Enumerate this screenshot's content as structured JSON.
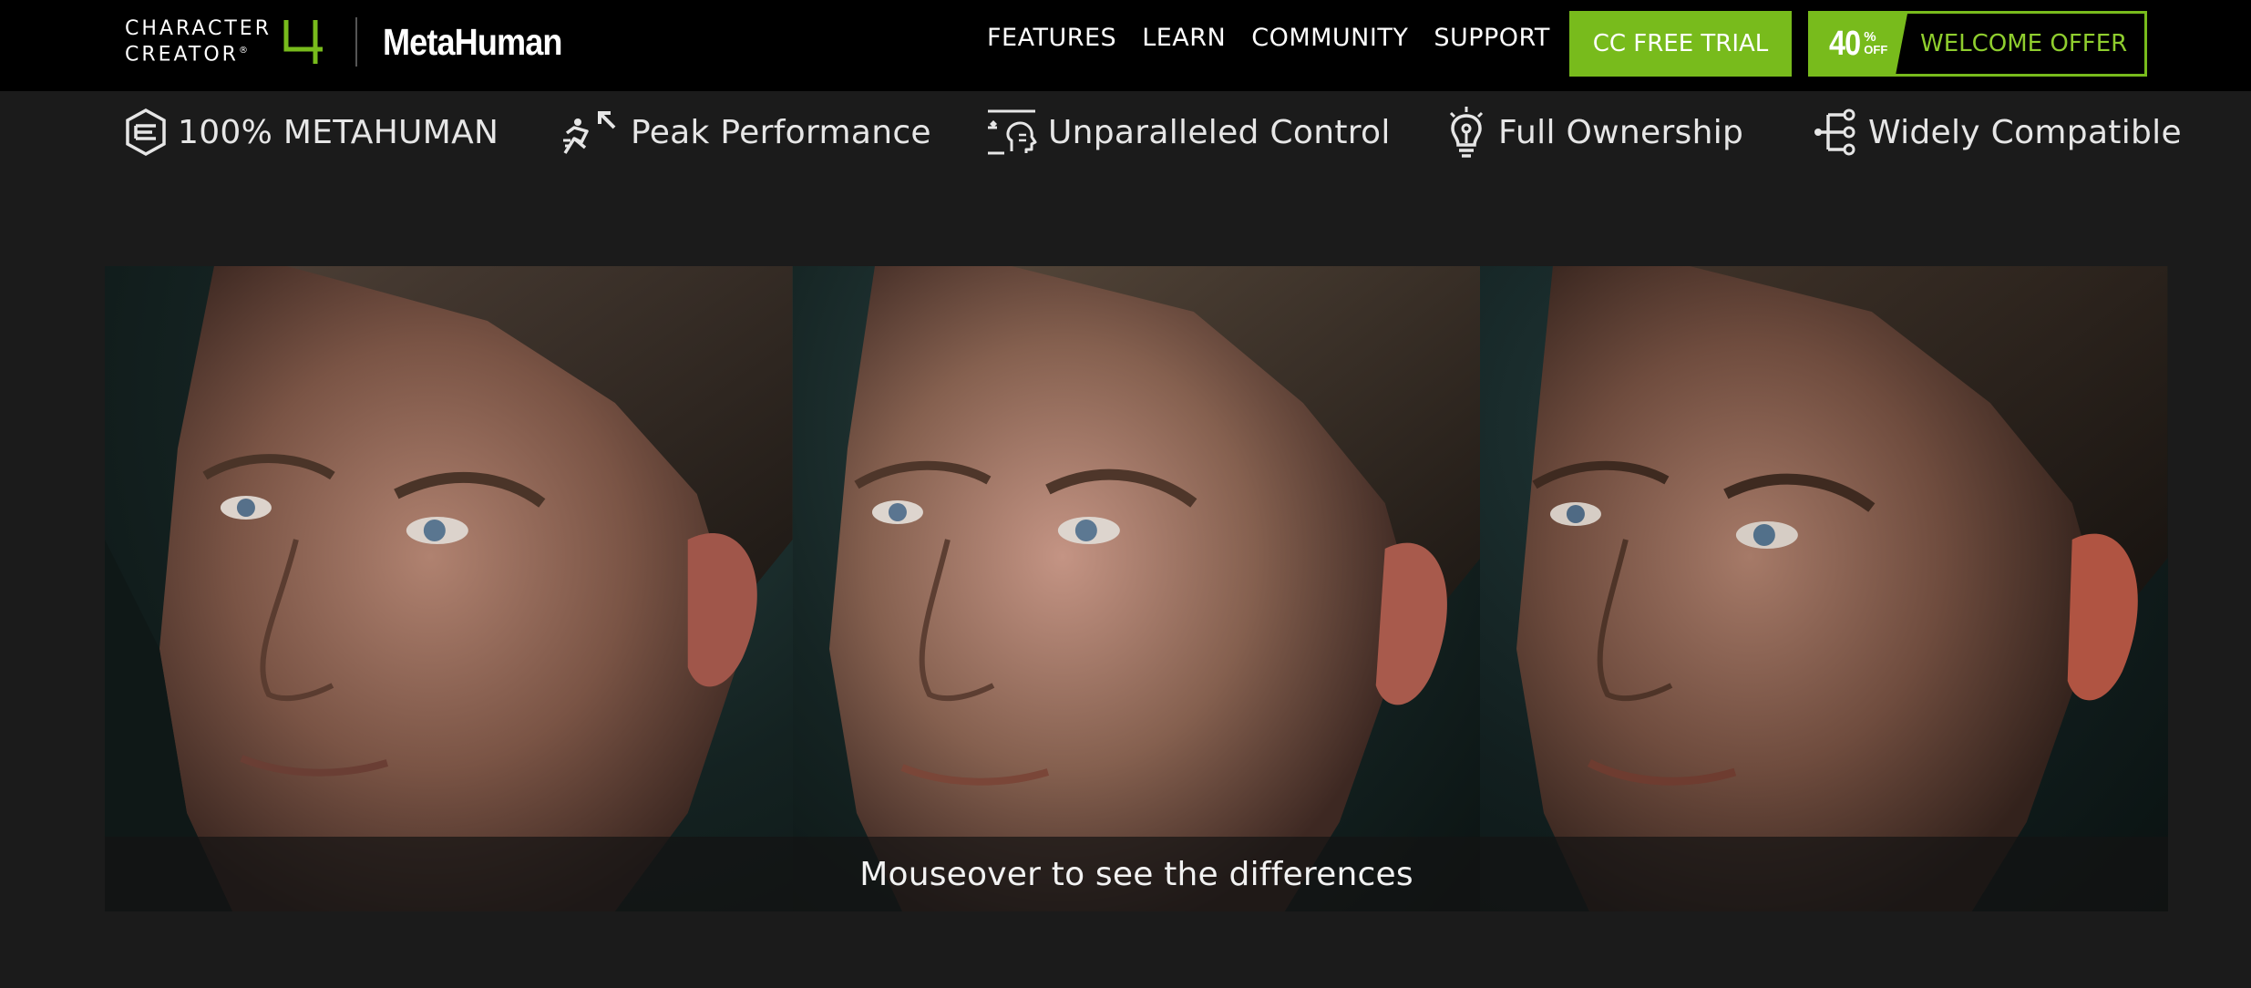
{
  "logo": {
    "line1": "CHARACTER",
    "line2": "CREATOR",
    "registered": "®",
    "version": "4",
    "product": "MetaHuman"
  },
  "nav": {
    "items": [
      "FEATURES",
      "LEARN",
      "COMMUNITY",
      "SUPPORT"
    ]
  },
  "cta": {
    "trial_label": "CC FREE TRIAL",
    "offer_number": "40",
    "offer_percent": "%",
    "offer_off": "OFF",
    "offer_label": "WELCOME OFFER"
  },
  "features": [
    {
      "label": "100% METAHUMAN",
      "icon": "metahuman-icon"
    },
    {
      "label": "Peak Performance",
      "icon": "performance-runner-icon"
    },
    {
      "label": "Unparalleled Control",
      "icon": "control-face-icon"
    },
    {
      "label": "Full Ownership",
      "icon": "lightbulb-icon"
    },
    {
      "label": "Widely Compatible",
      "icon": "branching-icon"
    }
  ],
  "comparison": {
    "caption": "Mouseover to see the differences"
  },
  "colors": {
    "accent": "#78bb1c",
    "accent_text": "#8fce2e",
    "topbar": "#000000",
    "background": "#1b1b1b"
  }
}
